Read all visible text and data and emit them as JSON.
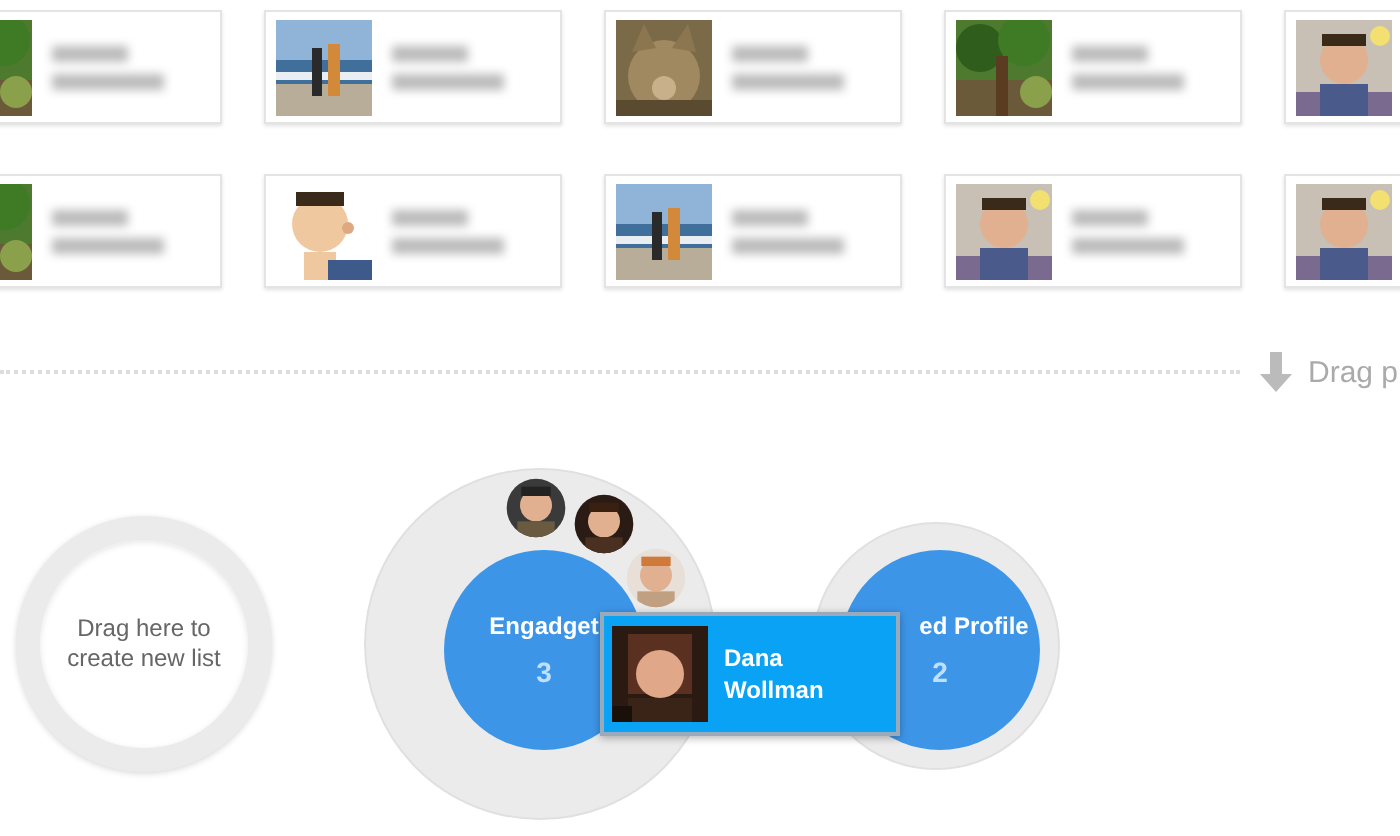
{
  "drag_hint": {
    "text": "Drag p"
  },
  "circles": [
    {
      "kind": "new",
      "label": "Drag here to create new list"
    },
    {
      "kind": "circle",
      "name": "Engadget",
      "count": "3"
    },
    {
      "kind": "circle",
      "name": "ed Profile",
      "count": "2"
    }
  ],
  "dragged_card": {
    "kind": "picture",
    "name": "Dana Wollman"
  }
}
